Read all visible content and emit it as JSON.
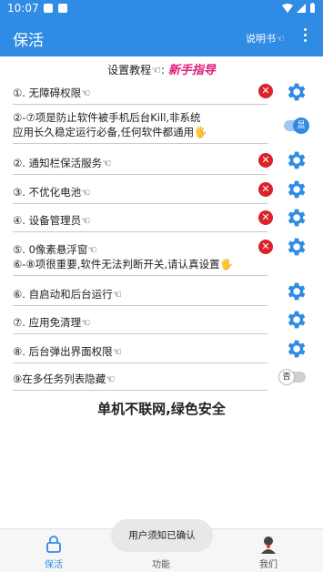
{
  "statusbar": {
    "time": "10:07"
  },
  "appbar": {
    "title": "保活",
    "manual_label": "说明书☜"
  },
  "tutorial": {
    "label": "设置教程☜:",
    "guide": "新手指导"
  },
  "rows": [
    {
      "text": "①. 无障碍权限☜"
    },
    {
      "line1": "②-⑦项是防止软件被手机后台Kill,非系统",
      "line2": "应用长久稳定运行必备,任何软件都通用🖐"
    },
    {
      "text": "②. 通知栏保活服务☜"
    },
    {
      "text": "③. 不优化电池☜"
    },
    {
      "text": "④. 设备管理员☜"
    },
    {
      "line1": "⑤. 0像素悬浮窗☜",
      "line2": "⑥-⑧项很重要,软件无法判断开关,请认真设置🖐"
    },
    {
      "text": "⑥. 自启动和后台运行☜"
    },
    {
      "text": "⑦. 应用免清理☜"
    },
    {
      "text": "⑧. 后台弹出界面权限☜"
    },
    {
      "text": "⑨在多任务列表隐藏☜"
    }
  ],
  "toggles": {
    "show_label": "显",
    "hide_label": "否"
  },
  "footer": {
    "text": "单机不联网,绿色安全"
  },
  "toast": {
    "text": "用户须知已确认"
  },
  "nav": [
    {
      "label": "保活"
    },
    {
      "label": "功能"
    },
    {
      "label": "我们"
    }
  ],
  "colors": {
    "primary": "#2f8be3",
    "danger": "#d9222a",
    "accent": "#e0187a"
  }
}
